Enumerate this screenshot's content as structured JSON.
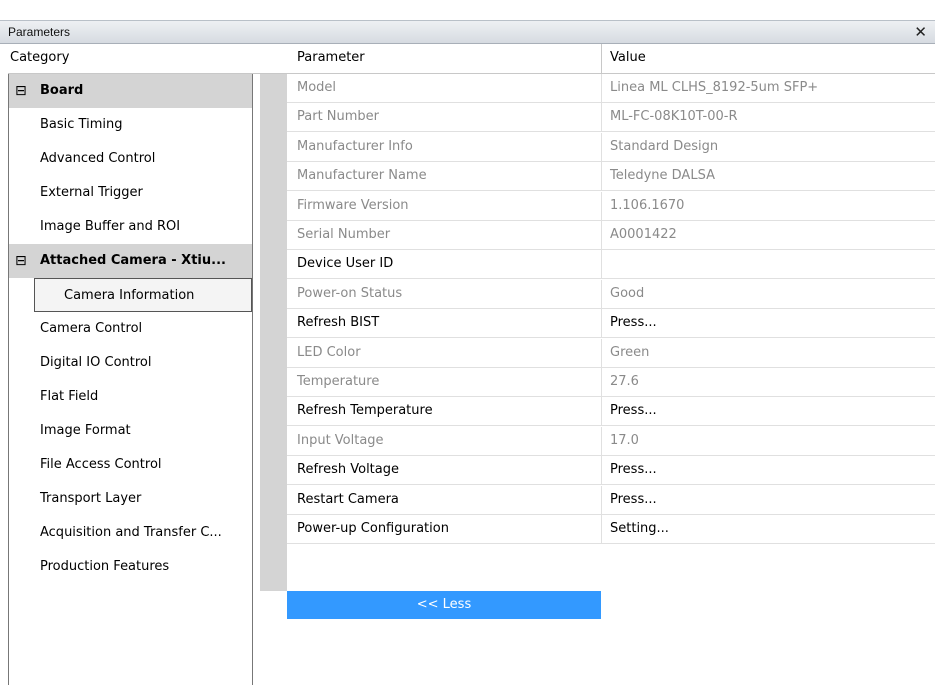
{
  "window": {
    "title": "Parameters",
    "close_glyph": "✕"
  },
  "category": {
    "header": "Category",
    "items": [
      {
        "label": "Board",
        "type": "group",
        "toggle": "⊟"
      },
      {
        "label": "Basic Timing",
        "type": "item"
      },
      {
        "label": "Advanced Control",
        "type": "item"
      },
      {
        "label": "External Trigger",
        "type": "item"
      },
      {
        "label": "Image Buffer and ROI",
        "type": "item"
      },
      {
        "label": "Attached Camera - Xtiu...",
        "type": "group",
        "toggle": "⊟"
      },
      {
        "label": "Camera Information",
        "type": "selected"
      },
      {
        "label": "Camera Control",
        "type": "item"
      },
      {
        "label": "Digital IO Control",
        "type": "item"
      },
      {
        "label": "Flat Field",
        "type": "item"
      },
      {
        "label": "Image Format",
        "type": "item"
      },
      {
        "label": "File Access Control",
        "type": "item"
      },
      {
        "label": "Transport Layer",
        "type": "item"
      },
      {
        "label": "Acquisition and Transfer C...",
        "type": "item"
      },
      {
        "label": "Production Features",
        "type": "item"
      }
    ]
  },
  "grid": {
    "header_parameter": "Parameter",
    "header_value": "Value",
    "rows": [
      {
        "parameter": "Model",
        "value": "Linea ML CLHS_8192-5um SFP+",
        "readonly": true
      },
      {
        "parameter": "Part Number",
        "value": "ML-FC-08K10T-00-R",
        "readonly": true
      },
      {
        "parameter": "Manufacturer Info",
        "value": "Standard Design",
        "readonly": true
      },
      {
        "parameter": "Manufacturer Name",
        "value": "Teledyne DALSA",
        "readonly": true
      },
      {
        "parameter": "Firmware Version",
        "value": "1.106.1670",
        "readonly": true
      },
      {
        "parameter": "Serial Number",
        "value": "A0001422",
        "readonly": true
      },
      {
        "parameter": "Device User ID",
        "value": "",
        "readonly": false
      },
      {
        "parameter": "Power-on Status",
        "value": "Good",
        "readonly": true
      },
      {
        "parameter": "Refresh BIST",
        "value": "Press...",
        "readonly": false
      },
      {
        "parameter": "LED Color",
        "value": "Green",
        "readonly": true
      },
      {
        "parameter": "Temperature",
        "value": "27.6",
        "readonly": true
      },
      {
        "parameter": "Refresh Temperature",
        "value": "Press...",
        "readonly": false
      },
      {
        "parameter": "Input Voltage",
        "value": "17.0",
        "readonly": true
      },
      {
        "parameter": "Refresh Voltage",
        "value": "Press...",
        "readonly": false
      },
      {
        "parameter": "Restart Camera",
        "value": "Press...",
        "readonly": false
      },
      {
        "parameter": "Power-up Configuration",
        "value": "Setting...",
        "readonly": false
      }
    ],
    "less_button": "<< Less"
  },
  "colors": {
    "accent": "#3399ff",
    "readonly_text": "#8a8a8a",
    "group_bg": "#d4d4d4"
  }
}
